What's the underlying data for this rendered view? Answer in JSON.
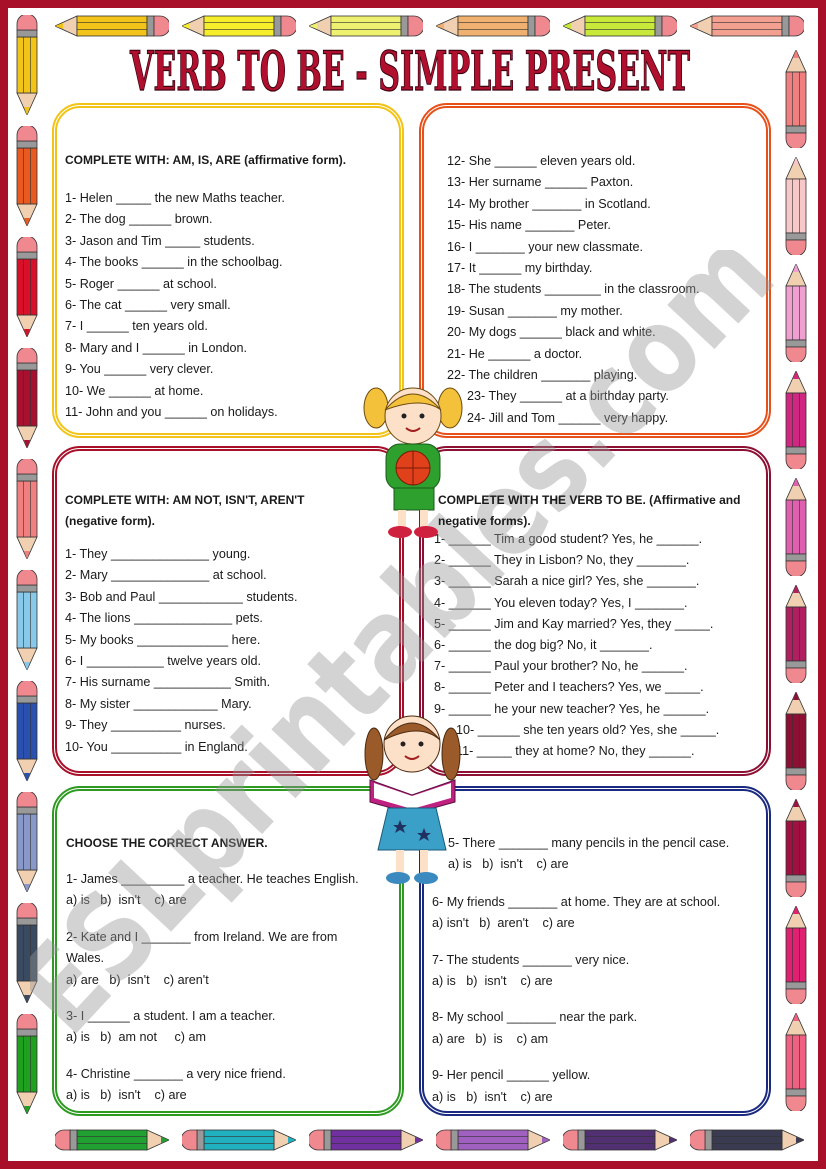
{
  "title": "VERB TO BE - SIMPLE PRESENT",
  "watermark": "ESLprintables.com",
  "colors": {
    "frame": "#a8102a",
    "title": "#b0102e",
    "box1": "#f2c318",
    "box2": "#e8501a",
    "box3": "#a8102a",
    "box4": "#8c1034",
    "box5": "#2e9a22",
    "box6": "#1a2a80"
  },
  "pencils": {
    "top": [
      "#f2c318",
      "#f6ee2a",
      "#eef070",
      "#f0b070",
      "#c8e83a",
      "#f4a090"
    ],
    "left": [
      "#f2c318",
      "#e85a20",
      "#d8102a",
      "#a81030",
      "#f08080",
      "#88c8e8",
      "#2a50b0",
      "#8898c8",
      "#3a4a60",
      "#20a020"
    ],
    "right": [
      "#f08080",
      "#f8c8c8",
      "#f0a0d0",
      "#d02880",
      "#e060b0",
      "#b02060",
      "#8c1034",
      "#a01040",
      "#e02070",
      "#f06080"
    ],
    "bottom": [
      "#20a030",
      "#20b0c0",
      "#7030a0",
      "#a060c0",
      "#503070",
      "#3a3a50"
    ]
  },
  "section1": {
    "heading": "COMPLETE WITH: AM, IS, ARE (affirmative form).",
    "items": [
      "1-  Helen _____ the new Maths teacher.",
      "2- The dog ______ brown.",
      "3- Jason and Tim _____ students.",
      "4- The books ______ in the schoolbag.",
      "5- Roger ______ at school.",
      "6- The cat ______ very small.",
      "7- I ______ ten years old.",
      "8- Mary and I ______ in London.",
      "9- You ______ very clever.",
      "10- We ______ at home.",
      "11- John and you ______ on holidays."
    ]
  },
  "section2": {
    "items": [
      "12- She ______ eleven years old.",
      "13- Her surname ______ Paxton.",
      "14-  My brother _______ in Scotland.",
      "15- His name _______ Peter.",
      "16- I _______ your new classmate.",
      "17- It ______ my birthday.",
      "18- The students ________ in the classroom.",
      "19- Susan _______ my mother.",
      "20-  My dogs ______ black and white.",
      "21- He ______ a doctor.",
      "22- The children _______ playing.",
      "23- They ______ at a birthday party.",
      "24- Jill and Tom ______ very happy."
    ]
  },
  "section3": {
    "heading_line1": "COMPLETE WITH: AM NOT, ISN'T, AREN'T",
    "heading_line2": "(negative form).",
    "items": [
      "1- They ______________ young.",
      "2- Mary ______________ at school.",
      "3- Bob and Paul ____________ students.",
      "4- The lions ______________ pets.",
      "5- My books _____________ here.",
      "6- I ___________ twelve years old.",
      "7- His surname ___________ Smith.",
      "8- My sister ____________ Mary.",
      "9- They __________ nurses.",
      "10- You __________ in England."
    ]
  },
  "section4": {
    "heading_line1": "COMPLETE WITH THE VERB TO BE. (Affirmative and",
    "heading_line2": "negative forms).",
    "items": [
      "1- ______ Tim a good student? Yes, he ______.",
      "2- ______ They in Lisbon? No, they _______.",
      "3- ______ Sarah a nice girl? Yes, she _______.",
      "4- ______ You eleven today? Yes, I _______.",
      "5- ______ Jim and Kay married? Yes, they _____.",
      "6- ______ the dog big? No, it _______.",
      "7- ______ Paul your brother? No, he ______.",
      "8- ______ Peter and I teachers? Yes, we _____.",
      "9- ______ he your new teacher? Yes, he ______.",
      "10- ______ she ten years old? Yes, she _____.",
      "11- _____ they at home? No, they ______."
    ]
  },
  "section5": {
    "heading": "CHOOSE THE CORRECT ANSWER.",
    "questions": [
      {
        "q": "1- James _________ a teacher. He teaches English.",
        "q2": "",
        "options": "a) is   b)  isn't    c) are"
      },
      {
        "q": "2- Kate  and  I  _______  from  Ireland.  We  are  from",
        "q2": "Wales.",
        "options": "a) are   b)  isn't    c) aren't"
      },
      {
        "q": "3- I ______ a student. I am a teacher.",
        "q2": "",
        "options": "a) is   b)  am not     c) am"
      },
      {
        "q": "4- Christine _______ a very nice friend.",
        "q2": "",
        "options": "a) is   b)  isn't    c) are"
      }
    ]
  },
  "section6": {
    "questions": [
      {
        "q": "5- There _______ many pencils in the pencil case.",
        "options": "a) is   b)  isn't    c) are"
      },
      {
        "q": "6- My friends _______ at home. They are at school.",
        "options": "a) isn't   b)  aren't    c) are"
      },
      {
        "q": "7- The students _______ very nice.",
        "options": "a) is   b)  isn't    c) are"
      },
      {
        "q": "8- My school _______ near the park.",
        "options": "a) are   b)  is    c) am"
      },
      {
        "q": "9- Her pencil ______ yellow.",
        "options": "a) is   b)  isn't    c) are"
      }
    ]
  }
}
